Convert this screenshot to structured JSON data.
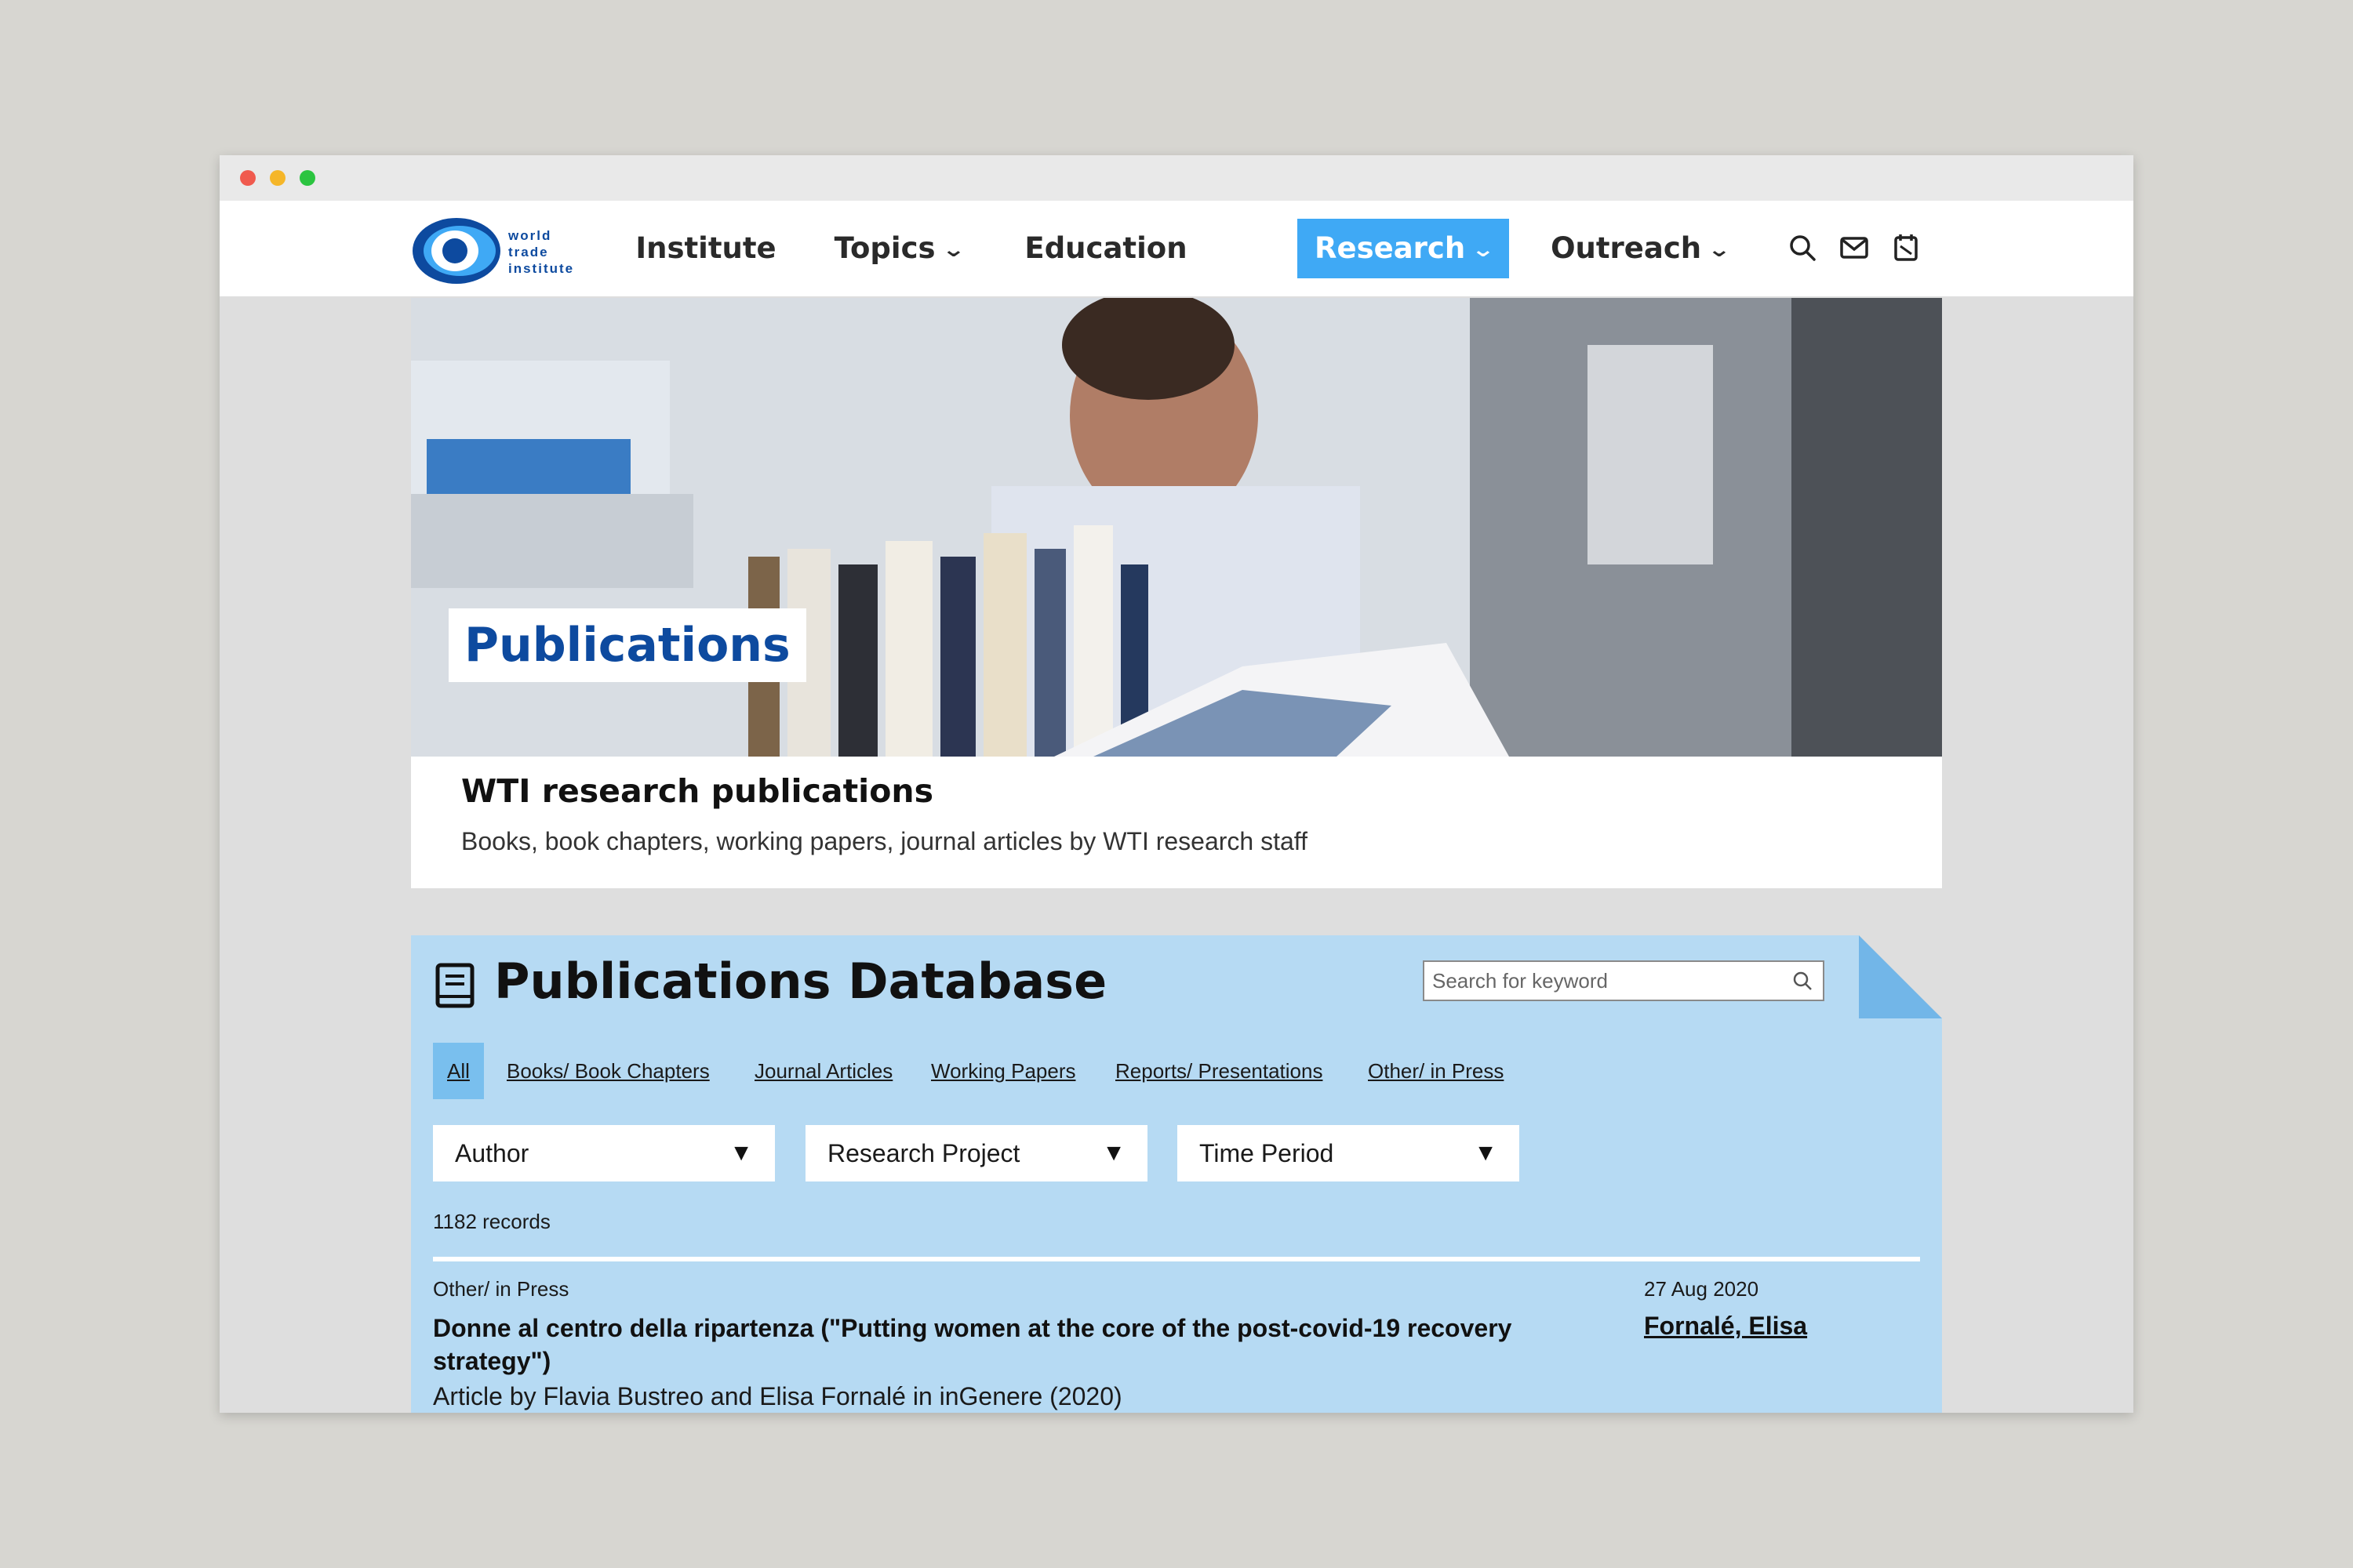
{
  "logo": {
    "line1": "world",
    "line2": "trade",
    "line3": "institute"
  },
  "nav": [
    {
      "label": "Institute"
    },
    {
      "label": "Topics"
    },
    {
      "label": "Education"
    },
    {
      "label": "Research"
    },
    {
      "label": "Outreach"
    }
  ],
  "nav_active": "Research",
  "nav_chevron": "❯",
  "header_icons": [
    "search-icon",
    "mail-icon",
    "calendar-icon"
  ],
  "hero": {
    "title": "Publications"
  },
  "intro": {
    "heading": "WTI research publications",
    "text": "Books, book chapters, working papers, journal articles by WTI research staff"
  },
  "database": {
    "title": "Publications Database",
    "search_placeholder": "Search for keyword",
    "tabs": [
      {
        "label": "All"
      },
      {
        "label": "Books/ Book Chapters"
      },
      {
        "label": "Journal Articles"
      },
      {
        "label": "Working Papers"
      },
      {
        "label": "Reports/ Presentations"
      },
      {
        "label": "Other/ in Press"
      }
    ],
    "active_tab": "All",
    "selects": [
      {
        "label": "Author"
      },
      {
        "label": "Research Project"
      },
      {
        "label": "Time Period"
      }
    ],
    "select_arrow": "▼",
    "records": "1182 records",
    "entry": {
      "type": "Other/ in Press",
      "date": "27 Aug 2020",
      "title": "Donne al centro della ripartenza (\"Putting women at the core of the post-covid-19 recovery strategy\")",
      "author": "Fornalé, Elisa",
      "description": "Article by Flavia Bustreo and Elisa Fornalé in inGenere (2020)"
    }
  },
  "colors": {
    "accent": "#3fa9f5",
    "brand_blue": "#0d4a9f",
    "db_background": "#b6daf3",
    "active_tab": "#79bfee"
  }
}
